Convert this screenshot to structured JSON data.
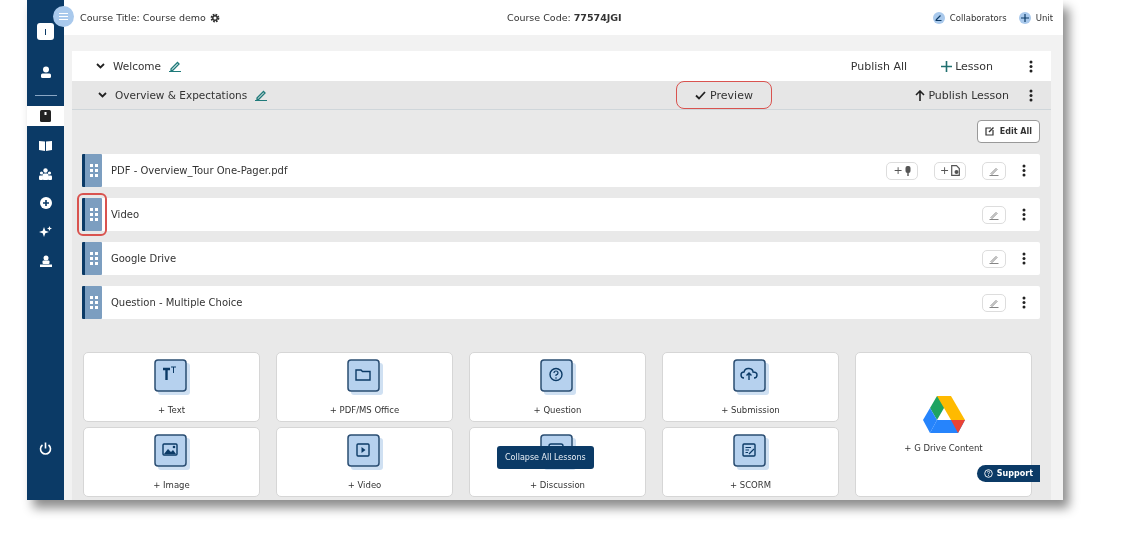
{
  "header": {
    "title": "Course Title: Course demo",
    "course_code": "Course Code: **77574JGI**",
    "actions": [
      {
        "label": "Collaborators",
        "kind": "collaborators"
      },
      {
        "label": "Unit",
        "kind": "add"
      }
    ]
  },
  "sidebar": {
    "items": [
      {
        "kind": "person",
        "selected": false
      },
      {
        "kind": "notebook",
        "selected": true
      },
      {
        "kind": "book",
        "selected": false
      },
      {
        "kind": "people",
        "selected": false
      },
      {
        "kind": "plus",
        "selected": false
      },
      {
        "kind": "sparkles",
        "selected": false
      },
      {
        "kind": "teacher",
        "selected": false
      }
    ]
  },
  "unit": {
    "title": "Welcome",
    "publish_all": "Publish All",
    "add_lesson": "Lesson"
  },
  "lesson": {
    "title": "Overview & Expectations",
    "preview": {
      "label": "Preview",
      "highlighted": true
    },
    "publish": "Publish Lesson",
    "edit_all": "Edit All"
  },
  "items": [
    {
      "title": "PDF - Overview_Tour One-Pager.pdf",
      "highlighted": false,
      "extras": [
        {
          "label": "+",
          "kind": "microphone"
        },
        {
          "label": "+",
          "kind": "document"
        }
      ]
    },
    {
      "title": "Video",
      "highlighted": true
    },
    {
      "title": "Google Drive",
      "highlighted": false
    },
    {
      "title": "Question - Multiple Choice",
      "highlighted": false
    }
  ],
  "add_content": [
    {
      "label": "+ Text",
      "kind": "text"
    },
    {
      "label": "+ PDF/MS Office",
      "kind": "folder"
    },
    {
      "label": "+ Question",
      "kind": "question"
    },
    {
      "label": "+ Submission",
      "kind": "upload"
    },
    {
      "label": "+ G Drive Content",
      "kind": "drive"
    },
    {
      "label": "+ Image",
      "kind": "image"
    },
    {
      "label": "+ Video",
      "kind": "video"
    },
    {
      "label": "+ Discussion",
      "kind": "discussion"
    },
    {
      "label": "+ SCORM",
      "kind": "scorm"
    }
  ],
  "tooltip": "Collapse All Lessons",
  "support": "Support"
}
